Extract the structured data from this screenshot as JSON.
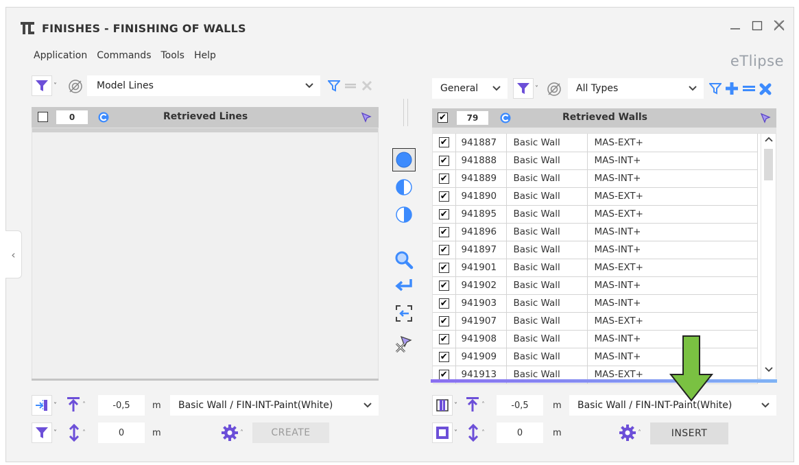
{
  "window": {
    "title": "FINISHES - FINISHING OF WALLS",
    "brand": "eTlipse"
  },
  "menu": [
    "Application",
    "Commands",
    "Tools",
    "Help"
  ],
  "left": {
    "category": "Model Lines",
    "count": "0",
    "header_title": "Retrieved Lines",
    "offset": "-0,5",
    "offset_unit": "m",
    "height": "0",
    "height_unit": "m",
    "wall_type": "Basic Wall / FIN-INT-Paint(White)",
    "action_label": "CREATE"
  },
  "right": {
    "scope": "General",
    "type_filter": "All Types",
    "count": "79",
    "header_title": "Retrieved Walls",
    "rows": [
      {
        "id": "941887",
        "family": "Basic Wall",
        "type": "MAS-EXT+"
      },
      {
        "id": "941888",
        "family": "Basic Wall",
        "type": "MAS-INT+"
      },
      {
        "id": "941889",
        "family": "Basic Wall",
        "type": "MAS-INT+"
      },
      {
        "id": "941890",
        "family": "Basic Wall",
        "type": "MAS-EXT+"
      },
      {
        "id": "941895",
        "family": "Basic Wall",
        "type": "MAS-EXT+"
      },
      {
        "id": "941896",
        "family": "Basic Wall",
        "type": "MAS-INT+"
      },
      {
        "id": "941897",
        "family": "Basic Wall",
        "type": "MAS-INT+"
      },
      {
        "id": "941901",
        "family": "Basic Wall",
        "type": "MAS-EXT+"
      },
      {
        "id": "941902",
        "family": "Basic Wall",
        "type": "MAS-INT+"
      },
      {
        "id": "941903",
        "family": "Basic Wall",
        "type": "MAS-INT+"
      },
      {
        "id": "941907",
        "family": "Basic Wall",
        "type": "MAS-EXT+"
      },
      {
        "id": "941908",
        "family": "Basic Wall",
        "type": "MAS-INT+"
      },
      {
        "id": "941909",
        "family": "Basic Wall",
        "type": "MAS-INT+"
      },
      {
        "id": "941913",
        "family": "Basic Wall",
        "type": "MAS-EXT+"
      }
    ],
    "offset": "-0,5",
    "offset_unit": "m",
    "height": "0",
    "height_unit": "m",
    "wall_type": "Basic Wall / FIN-INT-Paint(White)",
    "action_label": "INSERT"
  },
  "colors": {
    "accent": "#6c5ce7",
    "blue": "#3d8bfd",
    "arrow": "#7ac142"
  },
  "icons": {
    "filter": "filter-icon",
    "exclude": "exclude-icon",
    "refresh": "refresh-icon",
    "select": "cursor-icon"
  }
}
